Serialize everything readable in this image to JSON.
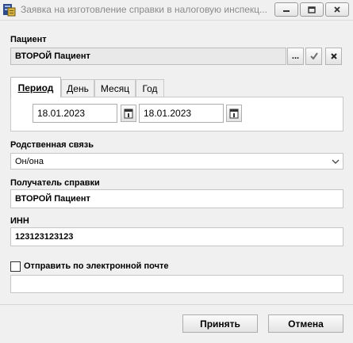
{
  "window": {
    "title": "Заявка на изготовление справки в налоговую инспекц...",
    "app_icon": "document-app-icon",
    "controls": [
      "minimize-icon",
      "restore-icon",
      "close-icon"
    ]
  },
  "patient": {
    "label": "Пациент",
    "value": "ВТОРОЙ Пациент",
    "browse_label": "...",
    "confirm_icon": "checkmark-icon",
    "clear_icon": "cross-icon"
  },
  "period_tabs": {
    "items": [
      {
        "label": "Период",
        "active": true
      },
      {
        "label": "День",
        "active": false
      },
      {
        "label": "Месяц",
        "active": false
      },
      {
        "label": "Год",
        "active": false
      }
    ],
    "date_from": "18.01.2023",
    "date_to": "18.01.2023",
    "calendar_icon": "calendar-icon"
  },
  "relation": {
    "label": "Родственная связь",
    "selected": "Он/она"
  },
  "recipient": {
    "label": "Получатель справки",
    "value": "ВТОРОЙ Пациент"
  },
  "inn": {
    "label": "ИНН",
    "value": "123123123123"
  },
  "email": {
    "checkbox_label": "Отправить по электронной почте",
    "checked": false,
    "value": ""
  },
  "buttons": {
    "accept": "Принять",
    "cancel": "Отмена"
  }
}
